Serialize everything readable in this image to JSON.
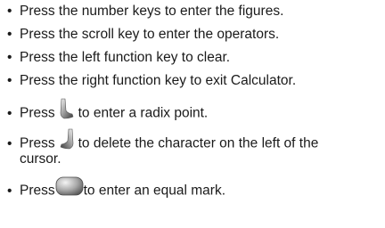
{
  "items": [
    {
      "bullet": "•",
      "text": "Press the number keys to enter the figures."
    },
    {
      "bullet": "•",
      "text": "Press the scroll key to enter the operators."
    },
    {
      "bullet": "•",
      "text": "Press the left function key to clear."
    },
    {
      "bullet": "•",
      "text": "Press the right function key to exit Calculator."
    },
    {
      "bullet": "•",
      "before": "Press",
      "icon": "left-soft-key-icon",
      "after": "to enter a radix point."
    },
    {
      "bullet": "•",
      "before": "Press",
      "icon": "right-soft-key-icon",
      "after": "to delete the character on the left of the",
      "continuation": "cursor."
    },
    {
      "bullet": "•",
      "before": "Press",
      "icon": "center-key-icon",
      "after": "to enter an equal mark."
    }
  ]
}
